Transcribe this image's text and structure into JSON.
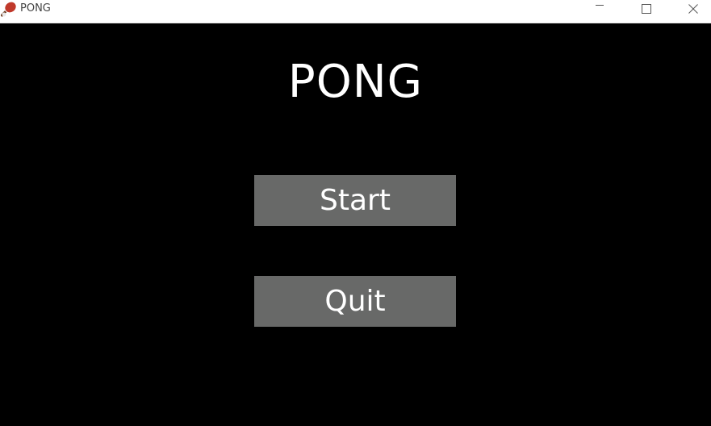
{
  "window": {
    "title": "PONG",
    "icon": "ping-pong-paddle-icon"
  },
  "game": {
    "title": "PONG",
    "start_label": "Start",
    "quit_label": "Quit"
  },
  "colors": {
    "background": "#000000",
    "button_fill": "#686968",
    "text": "#ffffff",
    "paddle_icon": "#c0392b"
  }
}
